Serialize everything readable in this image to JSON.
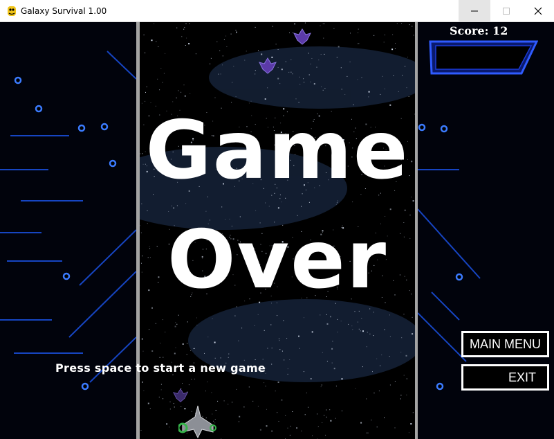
{
  "window": {
    "title": "Galaxy Survival 1.00",
    "controls": [
      "minimize",
      "maximize",
      "close"
    ]
  },
  "game": {
    "headline_line1": "Game",
    "headline_line2": "Over",
    "score_label": "Score: 12",
    "hint": "Press space to start a new game",
    "buttons": {
      "main_menu": "MAIN MENU",
      "exit": "EXIT"
    }
  },
  "colors": {
    "accent_blue": "#1e5bff",
    "divider_gray": "#a4a4a4",
    "text_white": "#ffffff"
  },
  "icons": {
    "app": "python-snake-icon",
    "player": "spaceship-icon",
    "enemy": "alien-ship-icon"
  }
}
